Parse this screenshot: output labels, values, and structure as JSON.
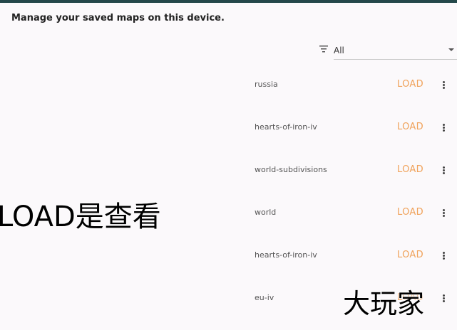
{
  "header": {
    "text": "Manage your saved maps on this device."
  },
  "filter": {
    "icon": "filter-icon",
    "value": "All"
  },
  "maps": [
    {
      "name": "russia",
      "load_label": "LOAD"
    },
    {
      "name": "hearts-of-iron-iv",
      "load_label": "LOAD"
    },
    {
      "name": "world-subdivisions",
      "load_label": "LOAD"
    },
    {
      "name": "world",
      "load_label": "LOAD"
    },
    {
      "name": "hearts-of-iron-iv",
      "load_label": "LOAD"
    },
    {
      "name": "eu-iv",
      "load_label": "LOAD"
    }
  ],
  "overlays": {
    "left": "LOAD是查看",
    "right": "大玩家"
  },
  "colors": {
    "accent": "#f0a25a",
    "top_bar": "#24484a",
    "background": "#fbf9fb"
  }
}
